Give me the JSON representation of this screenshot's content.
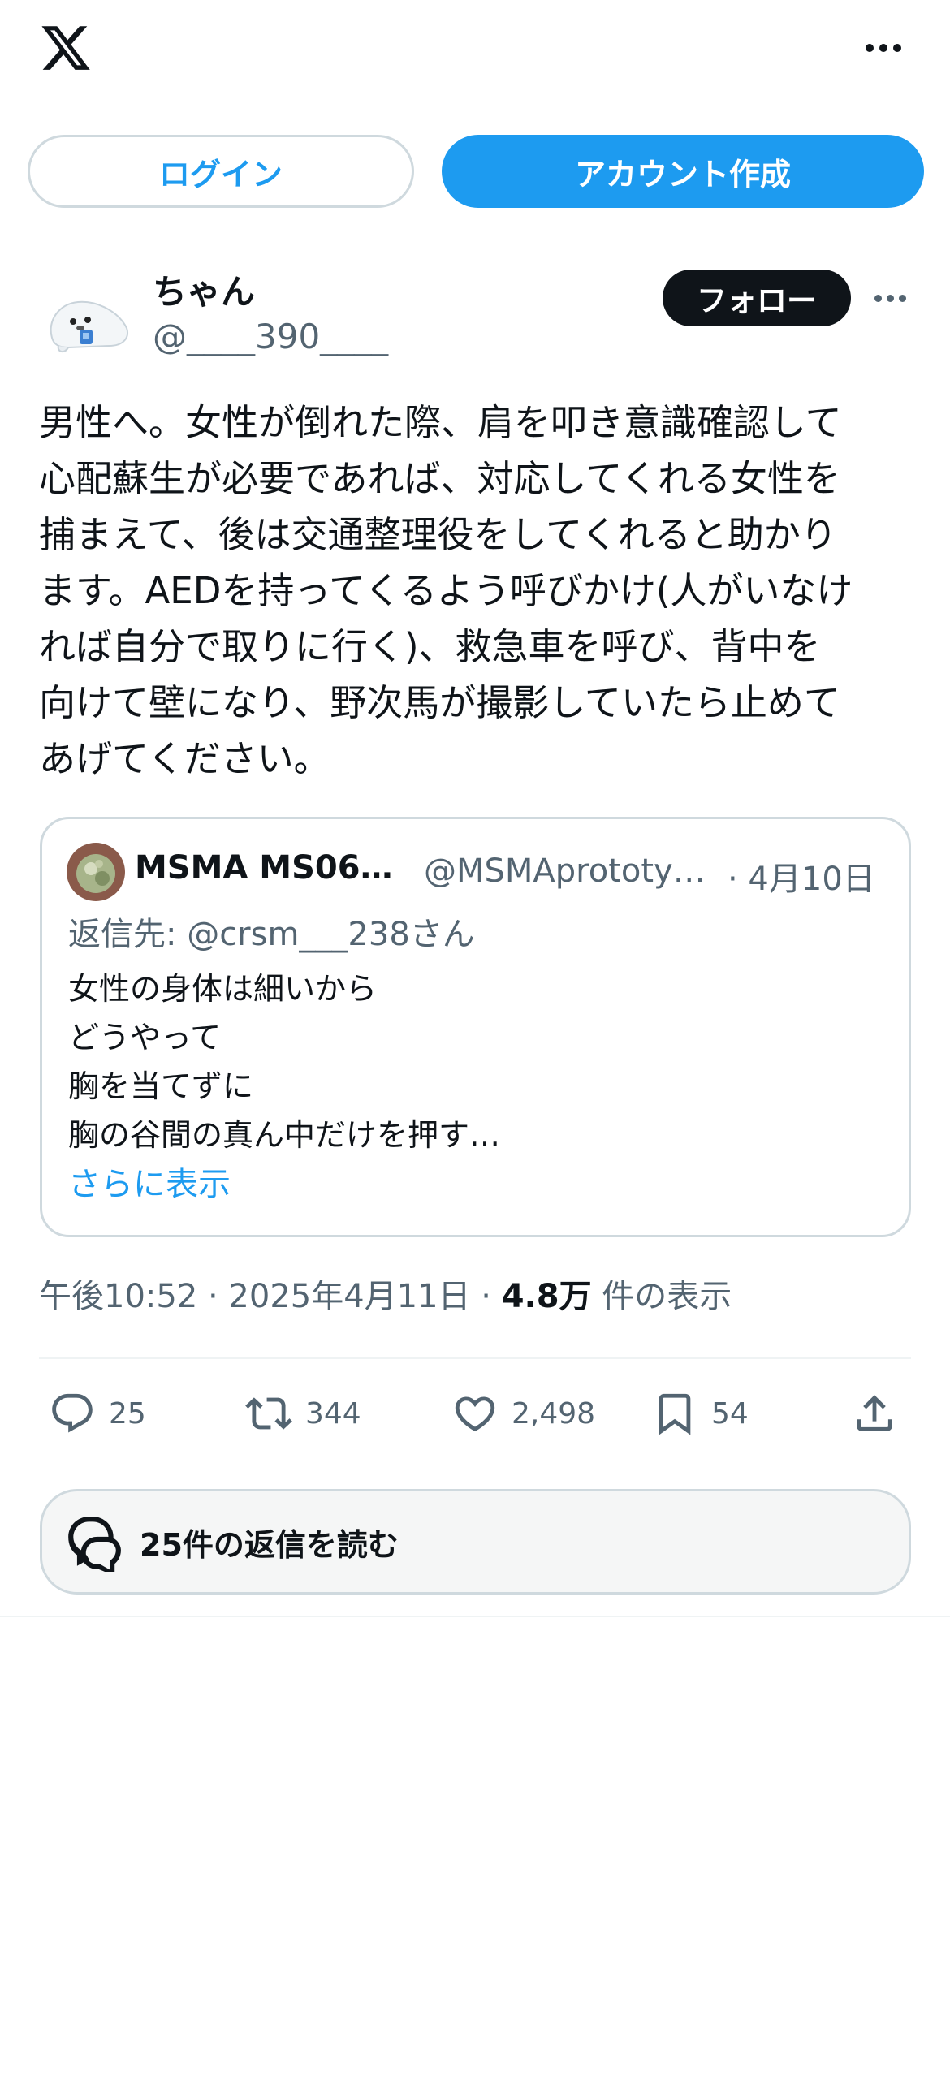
{
  "header": {
    "logo_icon": "x-logo-icon",
    "more_icon": "more-horizontal-icon",
    "login_label": "ログイン",
    "signup_label": "アカウント作成"
  },
  "author": {
    "name": "ちゃん",
    "handle": "@____390____",
    "follow_label": "フォロー"
  },
  "tweet": {
    "text": "男性へ。女性が倒れた際、肩を叩き意識確認して\n心配蘇生が必要であれば、対応してくれる女性を\n捕まえて、後は交通整理役をしてくれると助かり\nます。AEDを持ってくるよう呼びかけ(人がいなけ\nれば自分で取りに行く)、救急車を呼び、背中を\n向けて壁になり、野次馬が撮影していたら止めて\nあげてください。"
  },
  "quote": {
    "name": "MSMA MS06…",
    "handle": "@MSMAprototy…",
    "date": "· 4月10日",
    "reply_to": "返信先: @crsm___238さん",
    "lines": [
      "女性の身体は細いから",
      "どうやって",
      "胸を当てずに",
      "胸の谷間の真ん中だけを押す…"
    ],
    "show_more": "さらに表示"
  },
  "meta": {
    "time": "午後10:52 · 2025年4月11日 · ",
    "views_count": "4.8万",
    "views_label": " 件の表示"
  },
  "actions": {
    "reply_count": "25",
    "retweet_count": "344",
    "like_count": "2,498",
    "bookmark_count": "54"
  },
  "read_replies_label": "25件の返信を読む",
  "colors": {
    "accent": "#1d9bf0",
    "text_primary": "#0f1419",
    "text_secondary": "#536471",
    "border": "#cfd9de"
  }
}
